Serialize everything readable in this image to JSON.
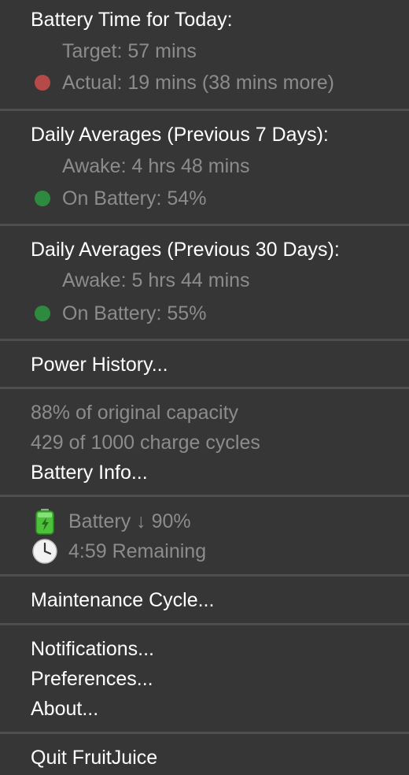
{
  "today": {
    "title": "Battery Time for Today:",
    "target": "Target: 57 mins",
    "actual": "Actual: 19 mins (38 mins more)",
    "status_color": "#b54a49"
  },
  "avg7": {
    "title": "Daily Averages (Previous 7 Days):",
    "awake": "Awake: 4 hrs 48 mins",
    "on_battery": "On Battery: 54%",
    "status_color": "#2e8a3e"
  },
  "avg30": {
    "title": "Daily Averages (Previous 30 Days):",
    "awake": "Awake: 5 hrs 44 mins",
    "on_battery": "On Battery: 55%",
    "status_color": "#2e8a3e"
  },
  "power_history_label": "Power History...",
  "battery_health": {
    "capacity": "88% of original capacity",
    "cycles": "429 of 1000 charge cycles",
    "info_label": "Battery Info..."
  },
  "battery_status": {
    "battery_icon": "battery-icon",
    "battery_text": "Battery ↓ 90%",
    "clock_icon": "clock-icon",
    "remaining_text": "4:59 Remaining"
  },
  "maintenance_label": "Maintenance Cycle...",
  "menu": {
    "notifications": "Notifications...",
    "preferences": "Preferences...",
    "about": "About..."
  },
  "quit_label": "Quit FruitJuice"
}
